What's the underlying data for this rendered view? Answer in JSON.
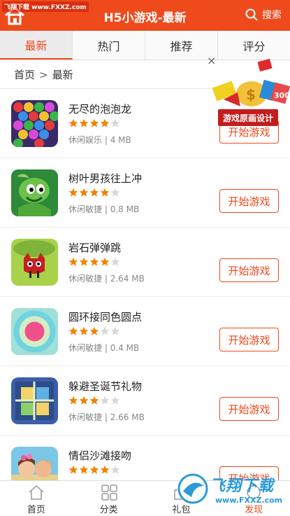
{
  "header": {
    "title": "H5小游戏-最新",
    "search_label": "搜索",
    "watermark": "飞翔下载 www.FXXZ.com"
  },
  "tabs": [
    {
      "label": "最新",
      "active": true
    },
    {
      "label": "热门",
      "active": false
    },
    {
      "label": "推荐",
      "active": false
    },
    {
      "label": "评分",
      "active": false
    }
  ],
  "breadcrumb": {
    "home": "首页",
    "separator": ">",
    "current": "最新"
  },
  "ad": {
    "label": "游戏原画设计",
    "close": "×"
  },
  "games": [
    {
      "name": "无尽的泡泡龙",
      "stars": 4,
      "category": "休闲娱乐",
      "size": "4 MB",
      "button": "开始游戏",
      "icon": "bubble-dragon-icon"
    },
    {
      "name": "树叶男孩往上冲",
      "stars": 4,
      "category": "休闲敏捷",
      "size": "0.8 MB",
      "button": "开始游戏",
      "icon": "leaf-boy-icon"
    },
    {
      "name": "岩石弹弹跳",
      "stars": 4,
      "category": "休闲敏捷",
      "size": "2.64 MB",
      "button": "开始游戏",
      "icon": "rock-bounce-icon"
    },
    {
      "name": "圆环接同色圆点",
      "stars": 3,
      "category": "休闲敏捷",
      "size": "0.4 MB",
      "button": "开始游戏",
      "icon": "ring-dots-icon"
    },
    {
      "name": "躲避圣诞节礼物",
      "stars": 3,
      "category": "休闲敏捷",
      "size": "2.66 MB",
      "button": "开始游戏",
      "icon": "christmas-gift-icon"
    },
    {
      "name": "情侣沙滩接吻",
      "stars": 4,
      "category": "",
      "size": "",
      "button": "开始游戏",
      "icon": "beach-kiss-icon"
    }
  ],
  "bottom_nav": [
    {
      "label": "首页",
      "icon": "home-icon"
    },
    {
      "label": "分类",
      "icon": "grid-icon"
    },
    {
      "label": "礼包",
      "icon": "gift-icon"
    },
    {
      "label": "发现",
      "icon": "discover-icon"
    }
  ],
  "watermark_bottom": {
    "brand": "飞翔下载",
    "url": "www.FXXZ.com"
  },
  "colors": {
    "accent": "#ef4a1c",
    "star_on": "#f08300",
    "star_off": "#d8d8d8"
  }
}
